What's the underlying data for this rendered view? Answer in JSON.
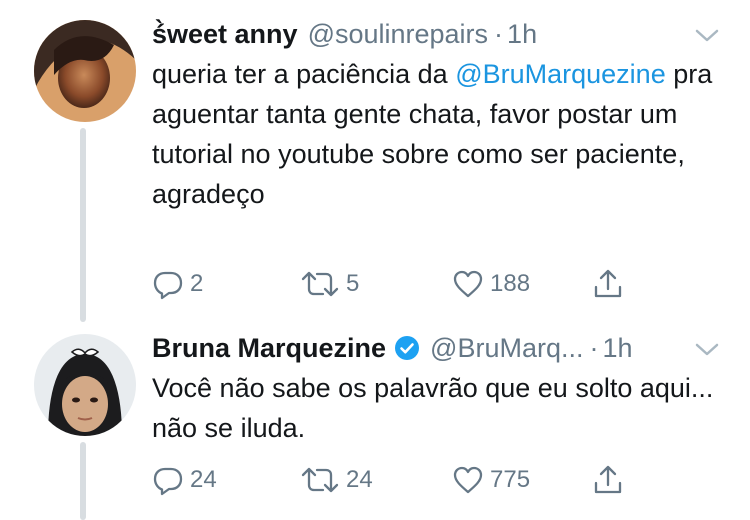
{
  "tweets": [
    {
      "name": "ś̀weet anny",
      "handle": "@soulinrepairs",
      "separator": "·",
      "time": "1h",
      "text_before": "queria ter a paciência da ",
      "mention": "@BruMarquezine",
      "text_after": " pra aguentar tanta gente chata, favor postar um tutorial no youtube sobre como ser paciente, agradeço",
      "reply_count": "2",
      "retweet_count": "5",
      "like_count": "188",
      "verified": false
    },
    {
      "name": "Bruna Marquezine",
      "handle": "@BruMarq...",
      "separator": "·",
      "time": "1h",
      "text": "Você não sabe os palavrão que eu solto aqui... não se iluda.",
      "reply_count": "24",
      "retweet_count": "24",
      "like_count": "775",
      "verified": true
    }
  ],
  "colors": {
    "text": "#14171a",
    "secondary": "#657786",
    "link": "#1b95e0",
    "verified": "#1da1f2",
    "thread_line": "#d8dde1"
  },
  "icons": [
    "reply-icon",
    "retweet-icon",
    "like-icon",
    "share-icon",
    "chevron-down-icon",
    "verified-badge-icon"
  ]
}
